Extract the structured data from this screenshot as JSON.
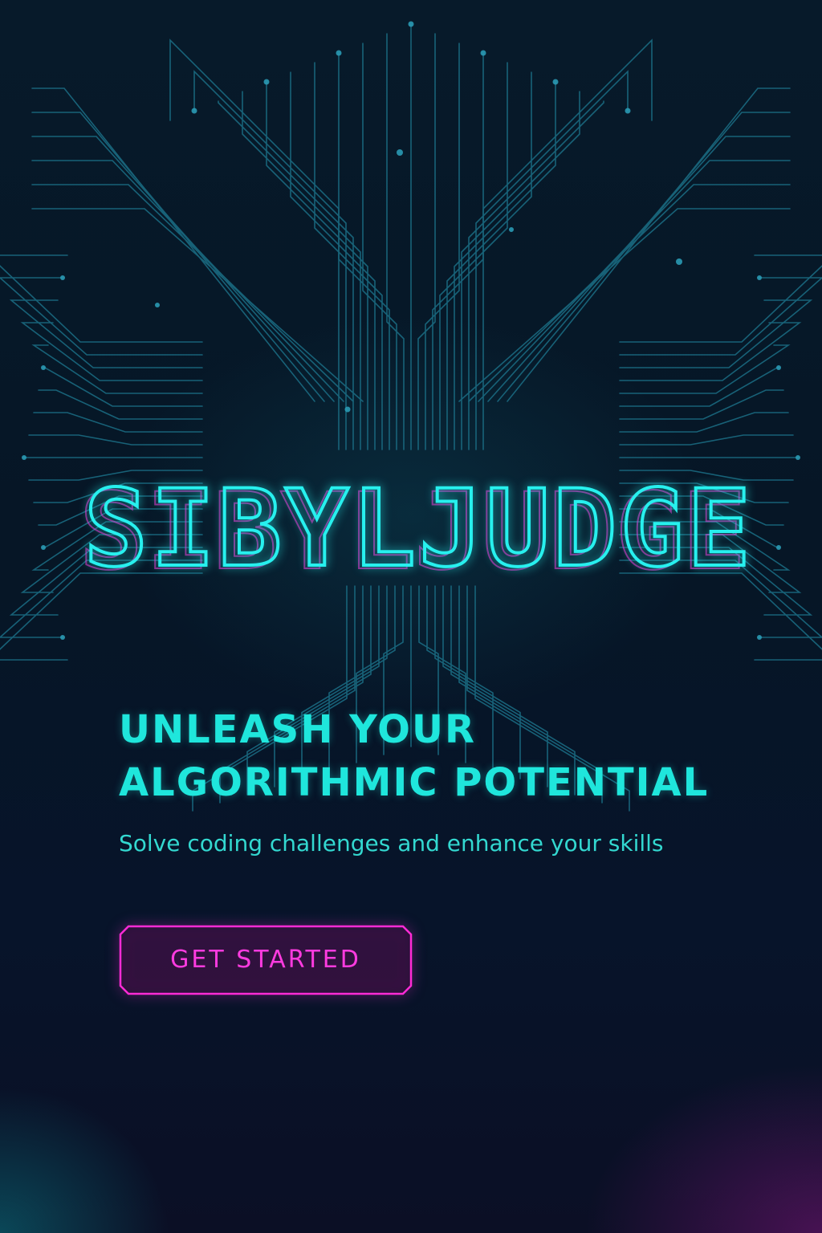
{
  "brand": {
    "name": "SIBYLJUDGE"
  },
  "hero": {
    "headline_line1": "UNLEASH YOUR",
    "headline_line2": "ALGORITHMIC POTENTIAL",
    "subtitle": "Solve coding challenges and enhance your skills"
  },
  "cta": {
    "label": "GET STARTED"
  },
  "colors": {
    "background": "#061726",
    "accent_cyan": "#27f0ee",
    "accent_magenta": "#ff2bd6",
    "circuit_lines": "#1b6f86"
  },
  "icons": {
    "background_graphic": "circuit-board-icon"
  }
}
